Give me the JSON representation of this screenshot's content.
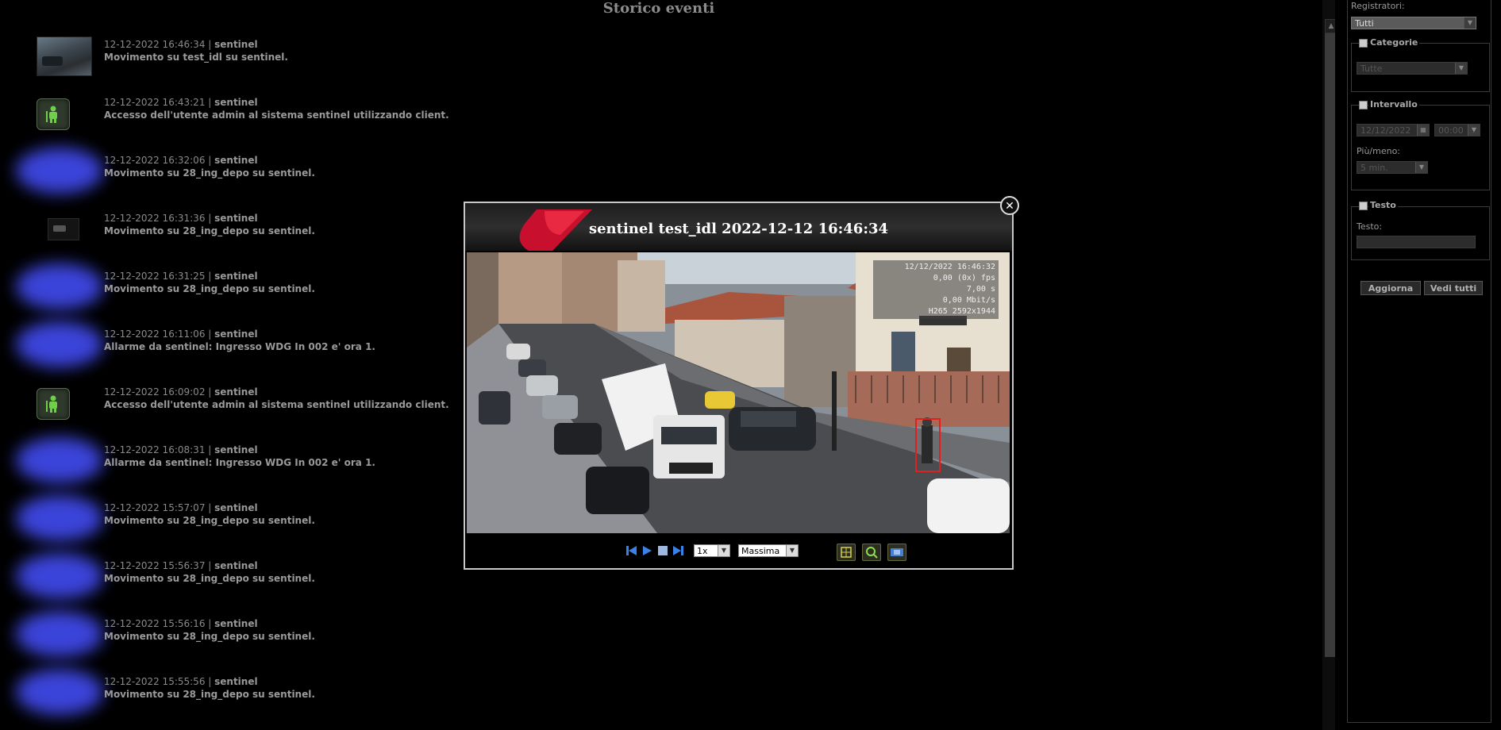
{
  "page": {
    "title": "Storico eventi"
  },
  "events": [
    {
      "thumb": "camera",
      "datetime": "12-12-2022 16:46:34",
      "source": "sentinel",
      "description": "Movimento su test_idl su sentinel."
    },
    {
      "thumb": "user-icon",
      "datetime": "12-12-2022 16:43:21",
      "source": "sentinel",
      "description": "Accesso dell'utente admin al sistema sentinel utilizzando client."
    },
    {
      "thumb": "blurred",
      "datetime": "12-12-2022 16:32:06",
      "source": "sentinel",
      "description": "Movimento su 28_ing_depo su sentinel."
    },
    {
      "thumb": "dark",
      "datetime": "12-12-2022 16:31:36",
      "source": "sentinel",
      "description": "Movimento su 28_ing_depo su sentinel."
    },
    {
      "thumb": "blurred",
      "datetime": "12-12-2022 16:31:25",
      "source": "sentinel",
      "description": "Movimento su 28_ing_depo su sentinel."
    },
    {
      "thumb": "blurred",
      "datetime": "12-12-2022 16:11:06",
      "source": "sentinel",
      "description": "Allarme da sentinel: Ingresso WDG In 002 e' ora 1."
    },
    {
      "thumb": "user-icon",
      "datetime": "12-12-2022 16:09:02",
      "source": "sentinel",
      "description": "Accesso dell'utente admin al sistema sentinel utilizzando client."
    },
    {
      "thumb": "blurred",
      "datetime": "12-12-2022 16:08:31",
      "source": "sentinel",
      "description": "Allarme da sentinel: Ingresso WDG In 002 e' ora 1."
    },
    {
      "thumb": "blurred",
      "datetime": "12-12-2022 15:57:07",
      "source": "sentinel",
      "description": "Movimento su 28_ing_depo su sentinel."
    },
    {
      "thumb": "blurred",
      "datetime": "12-12-2022 15:56:37",
      "source": "sentinel",
      "description": "Movimento su 28_ing_depo su sentinel."
    },
    {
      "thumb": "blurred",
      "datetime": "12-12-2022 15:56:16",
      "source": "sentinel",
      "description": "Movimento su 28_ing_depo su sentinel."
    },
    {
      "thumb": "blurred",
      "datetime": "12-12-2022 15:55:56",
      "source": "sentinel",
      "description": "Movimento su 28_ing_depo su sentinel."
    }
  ],
  "filters": {
    "registratori_label": "Registratori:",
    "registratori_value": "Tutti",
    "categorie_legend": "Categorie",
    "categorie_value": "Tutte",
    "intervallo_legend": "Intervallo",
    "date_value": "12/12/2022",
    "time_value": "00:00",
    "piumeno_label": "Più/meno:",
    "piumeno_value": "5 min.",
    "testo_legend": "Testo",
    "testo_label": "Testo:",
    "testo_value": "",
    "aggiorna_button": "Aggiorna",
    "vedi_tutti_button": "Vedi tutti"
  },
  "modal": {
    "title": "sentinel test_idl 2022-12-12 16:46:34",
    "osd": {
      "timestamp": "12/12/2022 16:46:32",
      "fps": "0,00 (0x) fps",
      "duration": "7,00 s",
      "bitrate": "0,00 Mbit/s",
      "codec": "H265 2592x1944"
    },
    "speed_value": "1x",
    "quality_value": "Massima",
    "icons": [
      "step-back-icon",
      "play-icon",
      "stop-icon",
      "step-forward-icon",
      "layout-icon",
      "zoom-icon",
      "snapshot-icon"
    ]
  },
  "colors": {
    "accent_red": "#d0142c",
    "blur_blue": "#3f48e6",
    "detection_box": "#e02020"
  }
}
